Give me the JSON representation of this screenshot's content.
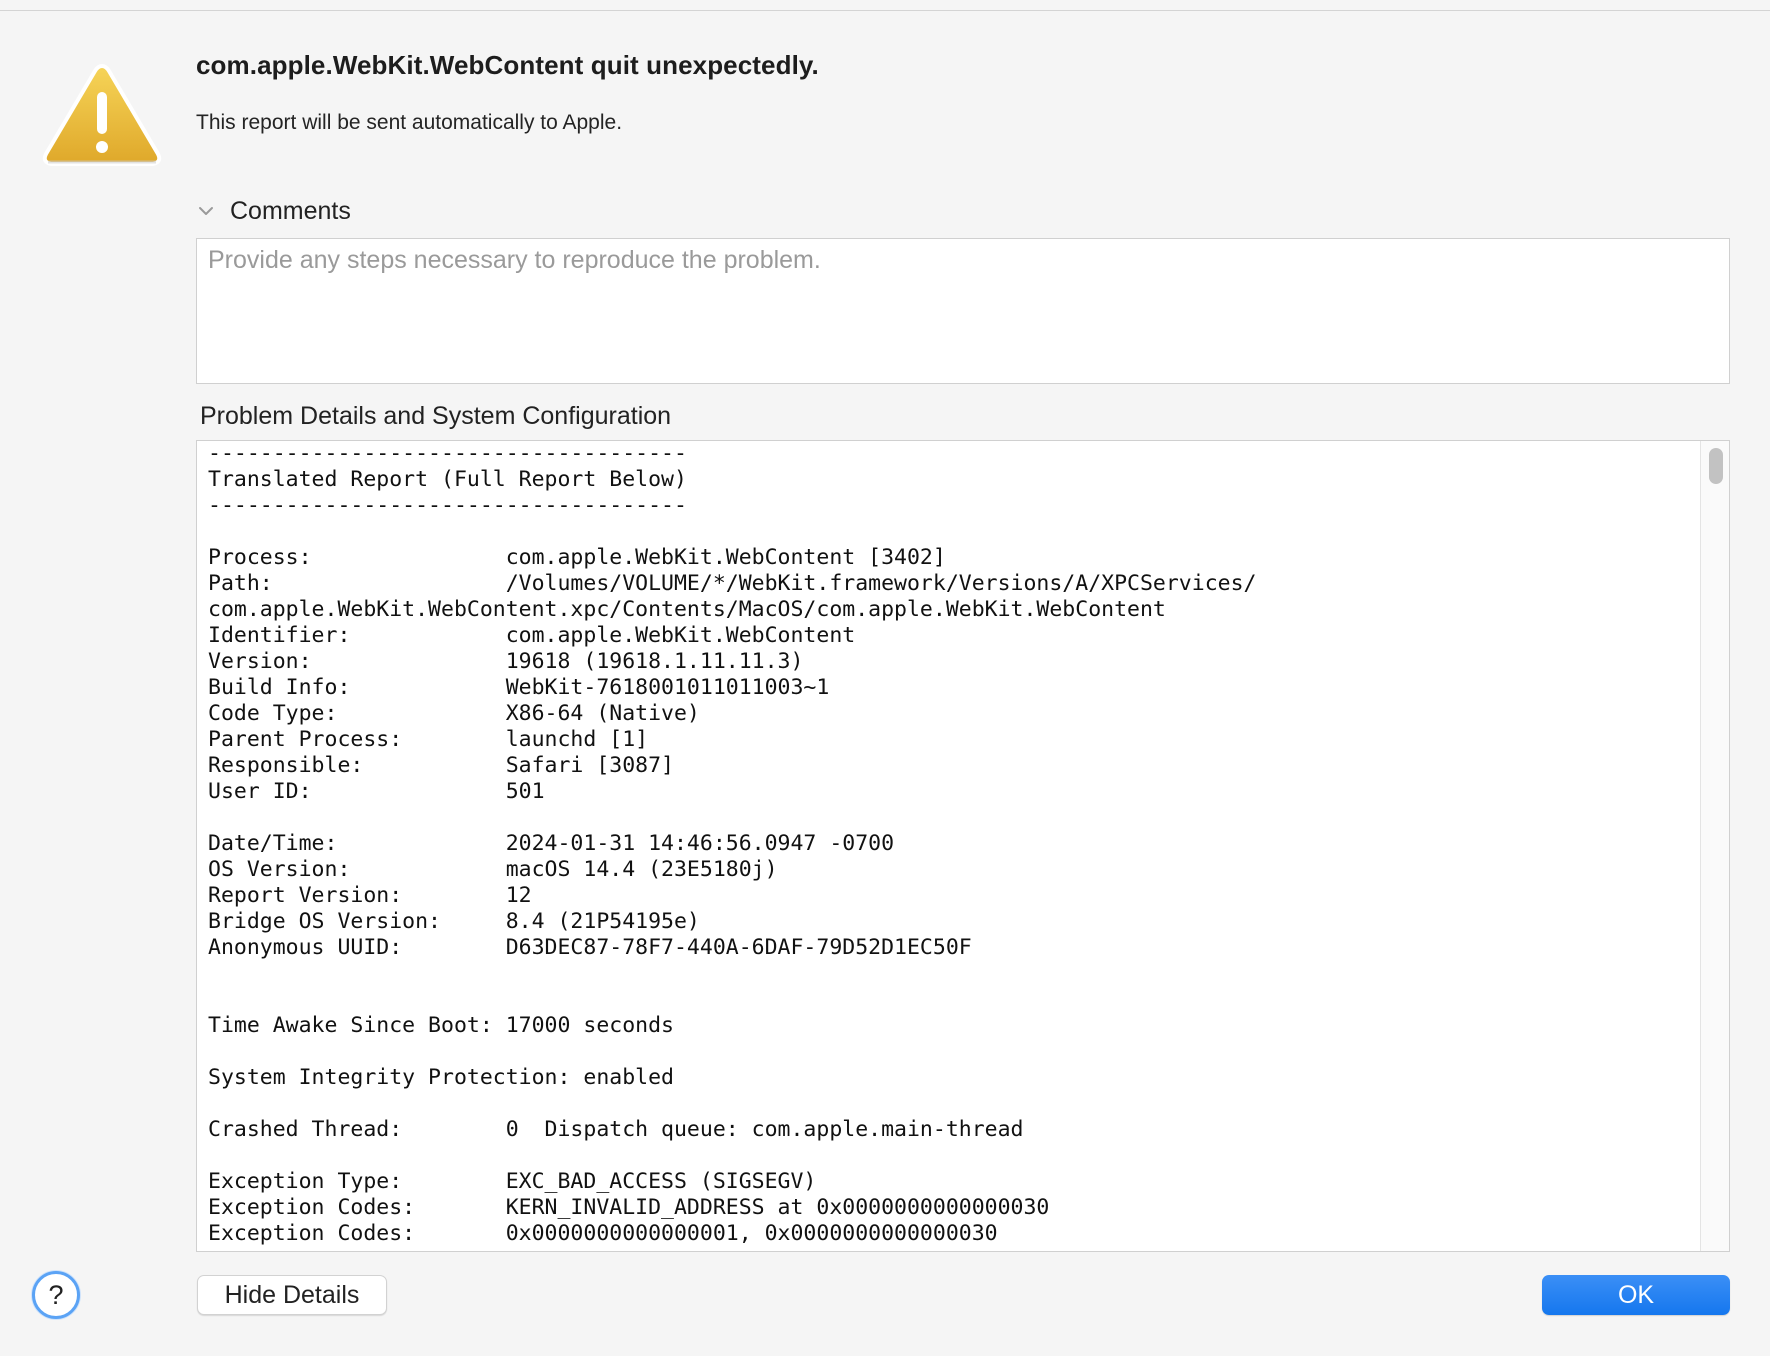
{
  "dialog": {
    "title": "com.apple.WebKit.WebContent quit unexpectedly.",
    "subtitle": "This report will be sent automatically to Apple.",
    "icon": "warning-triangle-icon",
    "icon_color": "#e8b72f"
  },
  "comments": {
    "label": "Comments",
    "placeholder": "Provide any steps necessary to reproduce the problem.",
    "value": ""
  },
  "details": {
    "label": "Problem Details and System Configuration",
    "report_lines": [
      "-------------------------------------",
      "Translated Report (Full Report Below)",
      "-------------------------------------",
      "",
      "Process:               com.apple.WebKit.WebContent [3402]",
      "Path:                  /Volumes/VOLUME/*/WebKit.framework/Versions/A/XPCServices/",
      "com.apple.WebKit.WebContent.xpc/Contents/MacOS/com.apple.WebKit.WebContent",
      "Identifier:            com.apple.WebKit.WebContent",
      "Version:               19618 (19618.1.11.11.3)",
      "Build Info:            WebKit-7618001011011003~1",
      "Code Type:             X86-64 (Native)",
      "Parent Process:        launchd [1]",
      "Responsible:           Safari [3087]",
      "User ID:               501",
      "",
      "Date/Time:             2024-01-31 14:46:56.0947 -0700",
      "OS Version:            macOS 14.4 (23E5180j)",
      "Report Version:        12",
      "Bridge OS Version:     8.4 (21P54195e)",
      "Anonymous UUID:        D63DEC87-78F7-440A-6DAF-79D52D1EC50F",
      "",
      "",
      "Time Awake Since Boot: 17000 seconds",
      "",
      "System Integrity Protection: enabled",
      "",
      "Crashed Thread:        0  Dispatch queue: com.apple.main-thread",
      "",
      "Exception Type:        EXC_BAD_ACCESS (SIGSEGV)",
      "Exception Codes:       KERN_INVALID_ADDRESS at 0x0000000000000030",
      "Exception Codes:       0x0000000000000001, 0x0000000000000030"
    ]
  },
  "buttons": {
    "help_label": "?",
    "hide_details_label": "Hide Details",
    "ok_label": "OK"
  },
  "colors": {
    "accent": "#1577ee",
    "help_ring": "#5ba3f5"
  }
}
